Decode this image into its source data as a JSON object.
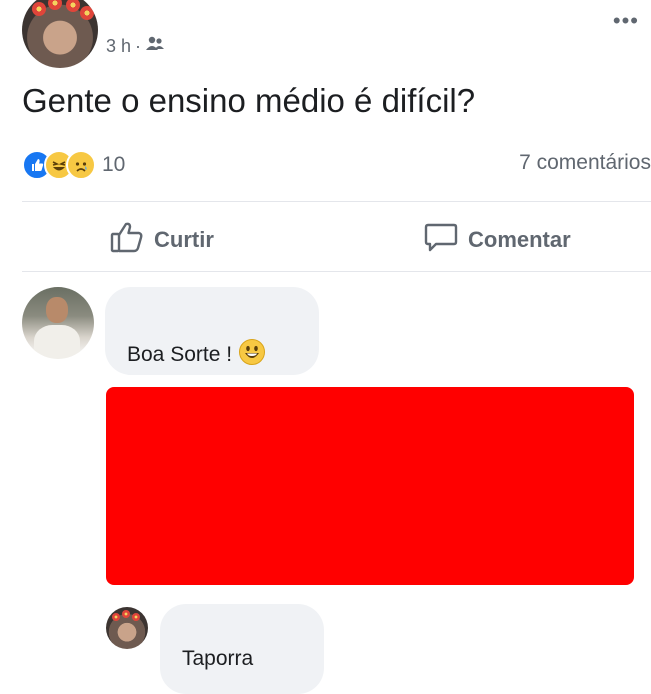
{
  "post": {
    "time": "3 h",
    "separator": "·",
    "privacy_icon": "friends-icon",
    "text": "Gente o ensino médio é difícil?",
    "more_icon": "more-dots-icon",
    "more_glyph": "•••"
  },
  "reactions": {
    "types": [
      "like-icon",
      "haha-icon",
      "sad-icon"
    ],
    "count": "10",
    "comments": "7 comentários"
  },
  "actions": {
    "like_label": "Curtir",
    "comment_label": "Comentar"
  },
  "comments": [
    {
      "text": "Boa Sorte !",
      "emoji": "smile-emoji-icon"
    },
    {
      "redacted": true,
      "color": "#ff0000"
    },
    {
      "text": "Taporra"
    }
  ],
  "colors": {
    "like_blue": "#1877f2",
    "meta_gray": "#606770",
    "bubble_bg": "#f0f2f5",
    "redaction": "#ff0000"
  }
}
